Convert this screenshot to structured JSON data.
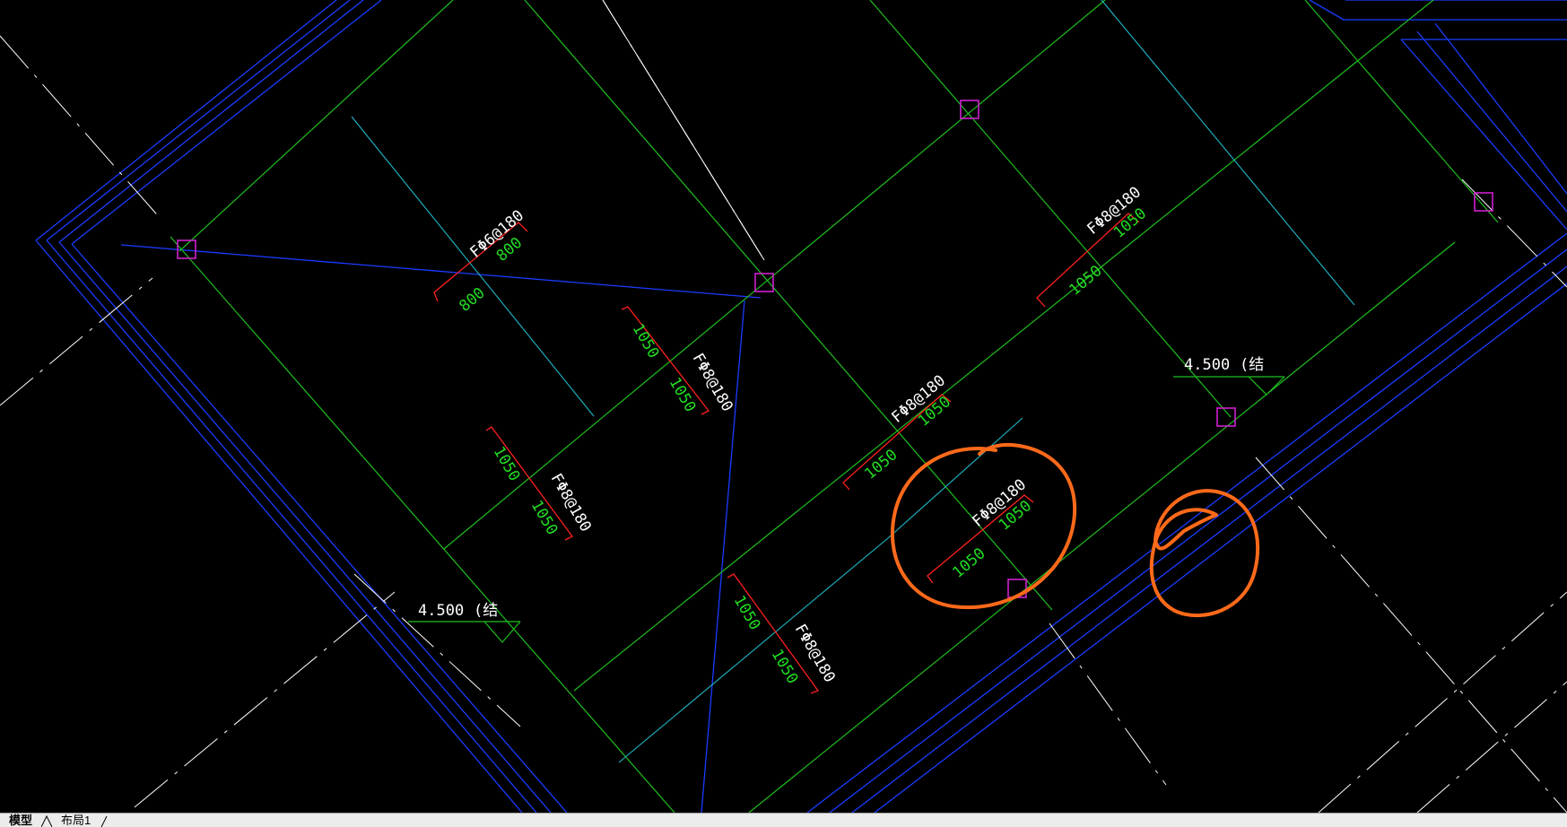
{
  "drawing": {
    "colors": {
      "background": "#000000",
      "beam_blue": "#1a3cff",
      "grid_green": "#1fbf1f",
      "cyan": "#20b8c8",
      "white": "#ffffff",
      "column_magenta": "#d020d0",
      "dim_red": "#ff2020",
      "text_green": "#22dd22",
      "markup_orange": "#ff6a1a"
    },
    "rebar_labels": [
      {
        "id": "r1",
        "spec": "FΦ6@180",
        "dim_a": "800",
        "dim_b": "800"
      },
      {
        "id": "r2",
        "spec": "FΦ8@180",
        "dim_a": "1050",
        "dim_b": "1050"
      },
      {
        "id": "r3",
        "spec": "FΦ8@180",
        "dim_a": "1050",
        "dim_b": "1050"
      },
      {
        "id": "r4",
        "spec": "FΦ8@180",
        "dim_a": "1050",
        "dim_b": "1050"
      },
      {
        "id": "r5",
        "spec": "FΦ8@180",
        "dim_a": "1050",
        "dim_b": "1050"
      },
      {
        "id": "r6",
        "spec": "FΦ8@180",
        "dim_a": "1050",
        "dim_b": "1050"
      },
      {
        "id": "r7",
        "spec": "FΦ8@180",
        "dim_a": "1050",
        "dim_b": "1050"
      }
    ],
    "elevations": [
      {
        "id": "e1",
        "value": "4.500",
        "suffix": "(结"
      },
      {
        "id": "e2",
        "value": "4.500",
        "suffix": "(结"
      }
    ]
  },
  "tabs": {
    "model": "模型",
    "layout1": "布局1"
  }
}
